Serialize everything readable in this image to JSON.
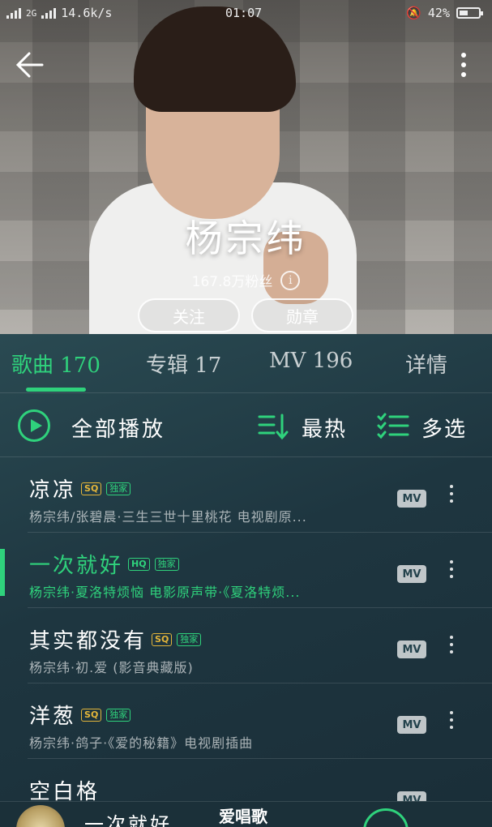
{
  "status_bar": {
    "signal_left": "2G",
    "speed": "14.6k/s",
    "time": "01:07",
    "battery": "42%"
  },
  "artist": {
    "name": "杨宗纬",
    "fans": "167.8万粉丝",
    "follow_label": "关注",
    "medal_label": "勋章"
  },
  "tabs": [
    {
      "label": "歌曲 170",
      "active": true
    },
    {
      "label": "专辑 17",
      "active": false
    },
    {
      "label": "MV 196",
      "active": false
    },
    {
      "label": "详情",
      "active": false
    }
  ],
  "toolbar": {
    "play_all": "全部播放",
    "sort": "最热",
    "multi_select": "多选"
  },
  "songs": [
    {
      "title": "凉凉",
      "quality": "SQ",
      "exclusive": "独家",
      "subtitle": "杨宗纬/张碧晨·三生三世十里桃花 电视剧原...",
      "mv": "MV",
      "playing": false
    },
    {
      "title": "一次就好",
      "quality": "HQ",
      "exclusive": "独家",
      "subtitle": "杨宗纬·夏洛特烦恼 电影原声带·《夏洛特烦...",
      "mv": "MV",
      "playing": true
    },
    {
      "title": "其实都没有",
      "quality": "SQ",
      "exclusive": "独家",
      "subtitle": "杨宗纬·初.爱 (影音典藏版)",
      "mv": "MV",
      "playing": false
    },
    {
      "title": "洋葱",
      "quality": "SQ",
      "exclusive": "独家",
      "subtitle": "杨宗纬·鸽子·《爱的秘籍》电视剧插曲",
      "mv": "MV",
      "playing": false
    },
    {
      "title": "空白格",
      "quality": "",
      "exclusive": "",
      "subtitle": "",
      "mv": "MV",
      "playing": false
    }
  ],
  "mini_player": {
    "title": "一次就好",
    "watermark": "爱唱歌"
  },
  "colors": {
    "accent": "#2fd27c",
    "badge_gold": "#e3b53a",
    "panel": "#1e3640"
  }
}
